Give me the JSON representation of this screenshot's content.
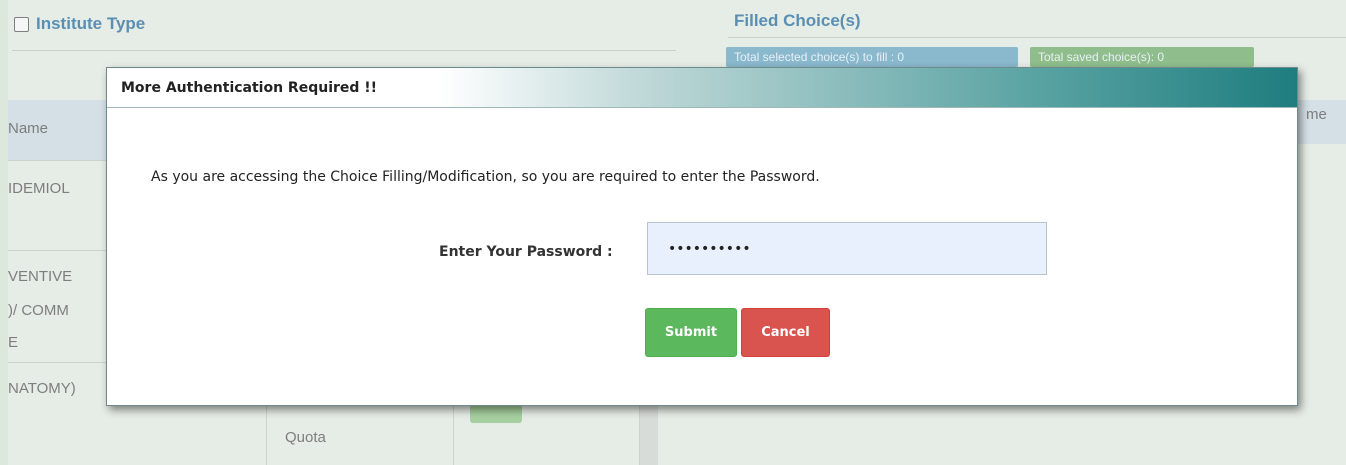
{
  "background": {
    "institute_type_label": "Institute Type",
    "filled_choices_title": "Filled Choice(s)",
    "badge_selected": "Total selected choice(s) to fill : 0",
    "badge_saved": "Total saved choice(s): 0",
    "col_name_left": "Name",
    "col_name_right": "me",
    "row_texts": [
      "IDEMIOL",
      "VENTIVE",
      ")/ COMM",
      "E",
      "NATOMY)"
    ],
    "quota_text": "Quota"
  },
  "modal": {
    "title": "More Authentication Required !!",
    "message": "As you are accessing the Choice Filling/Modification, so you are required to enter the Password.",
    "password_label": "Enter Your Password :",
    "password_value": "••••••••••",
    "submit_label": "Submit",
    "cancel_label": "Cancel"
  },
  "colors": {
    "header_gradient_end": "#1e7d7e",
    "submit": "#5cb85c",
    "cancel": "#d9534f",
    "input_bg": "#e8f0fe"
  }
}
